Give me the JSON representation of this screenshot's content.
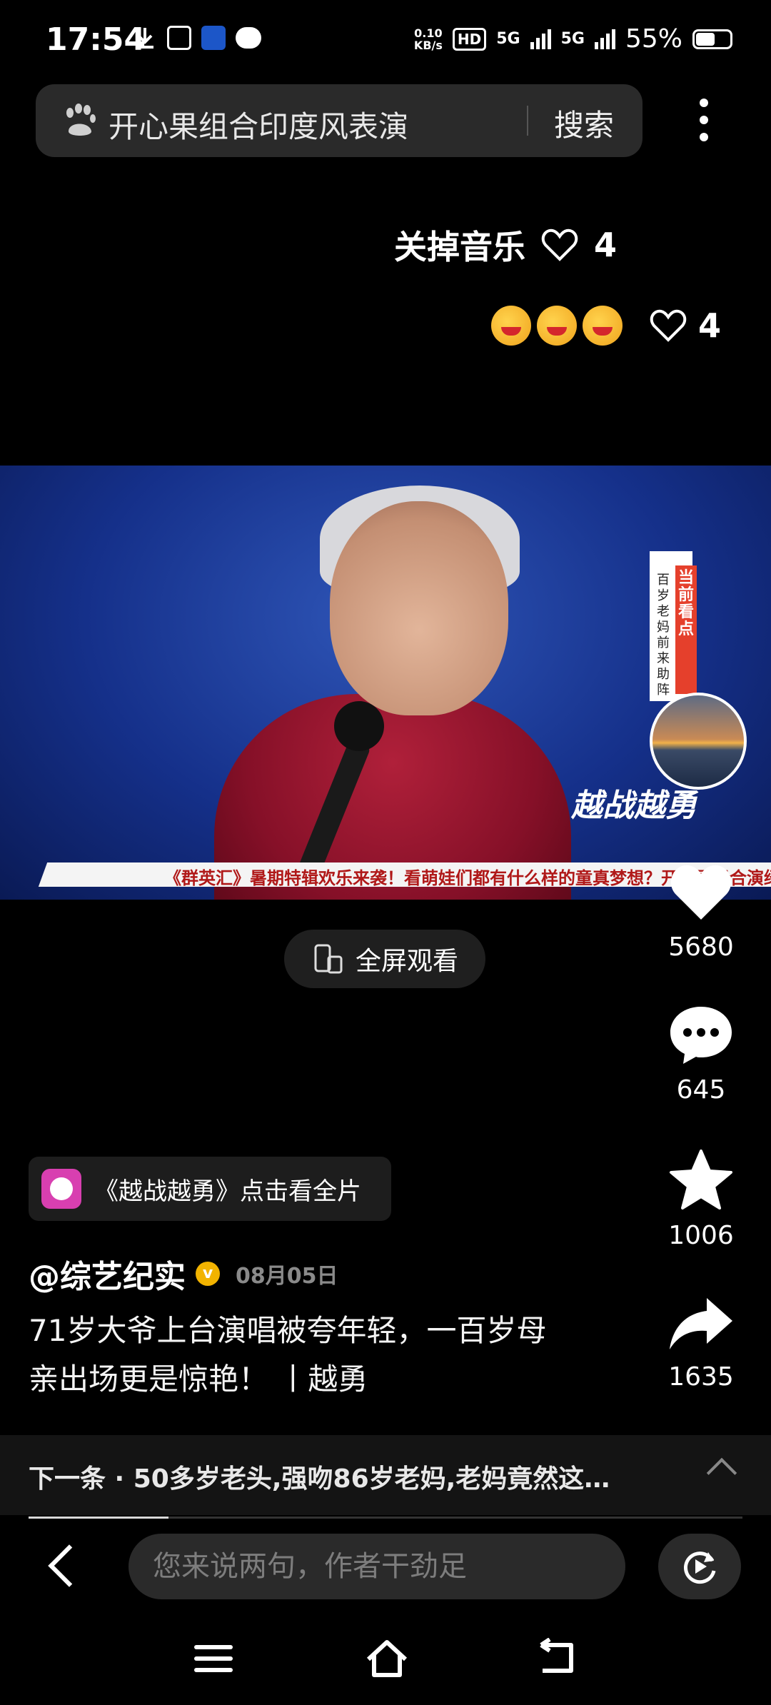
{
  "status_bar": {
    "time": "17:54",
    "net_speed_value": "0.10",
    "net_speed_unit": "KB/s",
    "hd_label": "HD",
    "signal_1": "5G",
    "signal_2": "5G",
    "battery": "55%"
  },
  "search": {
    "query": "开心果组合印度风表演",
    "button": "搜索"
  },
  "danmaku": [
    {
      "text": "关掉音乐",
      "likes": "4"
    },
    {
      "emoji_count": 3,
      "likes": "4"
    }
  ],
  "video": {
    "ticker": "《群英汇》暑期特辑欢乐来袭！看萌娃们都有什么样的童真梦想？开心果组合演绎",
    "sidebox_title": "当前看点",
    "sidebox_text": "百岁老妈 前来助阵",
    "logo": "越战越勇",
    "fullscreen_label": "全屏观看"
  },
  "actions": {
    "likes": "5680",
    "comments": "645",
    "favorites": "1006",
    "shares": "1635"
  },
  "film_tag": "《越战越勇》点击看全片",
  "author": {
    "name": "@综艺纪实",
    "verified_icon": "v",
    "date": "08月05日"
  },
  "description": "71岁大爷上台演唱被夸年轻，一百岁母亲出场更是惊艳！ 丨越勇",
  "next": {
    "text": "下一条 · 50多岁老头,强吻86岁老妈,老妈竟然这…"
  },
  "progress": 0.196,
  "input": {
    "placeholder": "您来说两句，作者干劲足"
  },
  "colors": {
    "background": "#000000",
    "pill": "#2a2a2a",
    "verified": "#f2b300",
    "film_icon": "#d83fb0"
  }
}
